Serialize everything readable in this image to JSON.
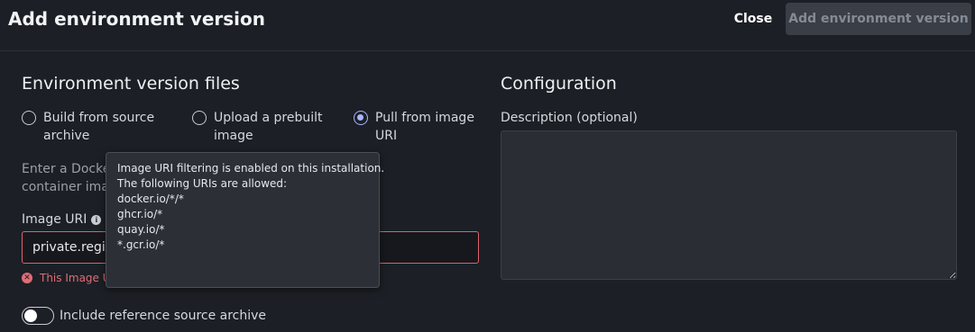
{
  "header": {
    "title": "Add environment version",
    "close_label": "Close",
    "submit_label": "Add environment version"
  },
  "files": {
    "title": "Environment version files",
    "options": [
      {
        "line1": "Build from source",
        "line2": "archive",
        "checked": false
      },
      {
        "line1": "Upload a prebuilt",
        "line2": "image",
        "checked": false
      },
      {
        "line1": "Pull from image",
        "line2": "URI",
        "checked": true
      }
    ],
    "helper_line1": "Enter a Docker image URI to pull an image from a",
    "helper_line2": "container image registry.",
    "image_uri_label": "Image URI",
    "image_uri_value": "private.registry.example.com/image:latest",
    "error_text": "This Image URI is not allowed.",
    "toggle_label": "Include reference source archive",
    "toggle_on": false
  },
  "configuration": {
    "title": "Configuration",
    "description_label": "Description (optional)",
    "description_value": ""
  },
  "tooltip": {
    "line1": "Image URI filtering is enabled on this installation.",
    "line2": "The following URIs are allowed:",
    "allowed": [
      "docker.io/*/*",
      "ghcr.io/*",
      "quay.io/*",
      "*.gcr.io/*"
    ]
  },
  "colors": {
    "background": "#1c1f25",
    "accent": "#aab4ff",
    "error": "#e06c76"
  }
}
